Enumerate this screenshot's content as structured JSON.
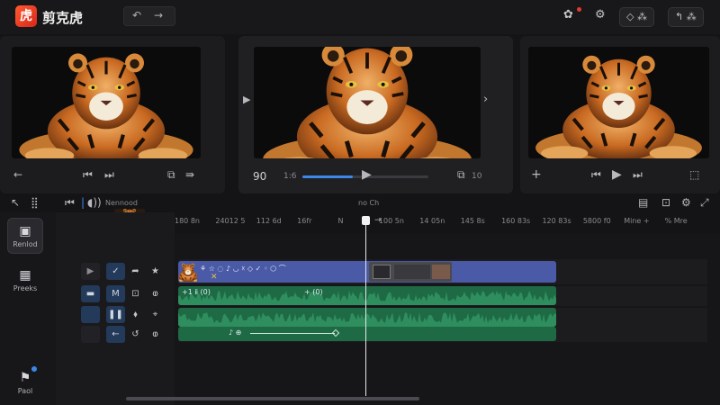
{
  "app": {
    "logo_glyph": "虎",
    "title": "剪克虎"
  },
  "toolbar": {
    "undo_icon": "undo-icon",
    "redo_icon": "redo-icon",
    "right_actions": [
      {
        "name": "effects-icon",
        "glyph": "✿"
      },
      {
        "name": "settings-icon",
        "glyph": "⚙"
      },
      {
        "name": "view-toggle",
        "glyph": "◇ ⁂"
      },
      {
        "name": "export-button",
        "glyph": "↰ ⁂"
      }
    ]
  },
  "preview": {
    "current_time": "90",
    "small_time": "1:6",
    "end_time": "10",
    "progress_fraction": 0.4,
    "accent": "#3c88e8"
  },
  "timeline": {
    "toolbar_label": "Nennood",
    "center_label": "no Ch",
    "brand_caption": "剪 虎",
    "ruler_labels": [
      "180 8n",
      "24012 5",
      "112 6d",
      "16fr",
      "N",
      "100 5n",
      "14 05n",
      "145 8s",
      "160 83s",
      "120 83s",
      "5800 f0",
      "Mine +",
      "% Mre"
    ],
    "video_clip_text": "⚘ ☆ ◌ ♪ ◡ ☓ ◇ ✓ ◦ ⬡ ⌒",
    "audio_clip_1_labels": [
      "+1 ⅱ (0)",
      "+ (0)"
    ],
    "audio_clip_3_label": "♪ ⊕"
  },
  "sidebar": {
    "items": [
      {
        "label": "Renlod",
        "icon": "media-icon"
      },
      {
        "label": "Preeks",
        "icon": "grid-icon"
      },
      {
        "label": "Paol",
        "icon": "flag-icon"
      }
    ]
  }
}
